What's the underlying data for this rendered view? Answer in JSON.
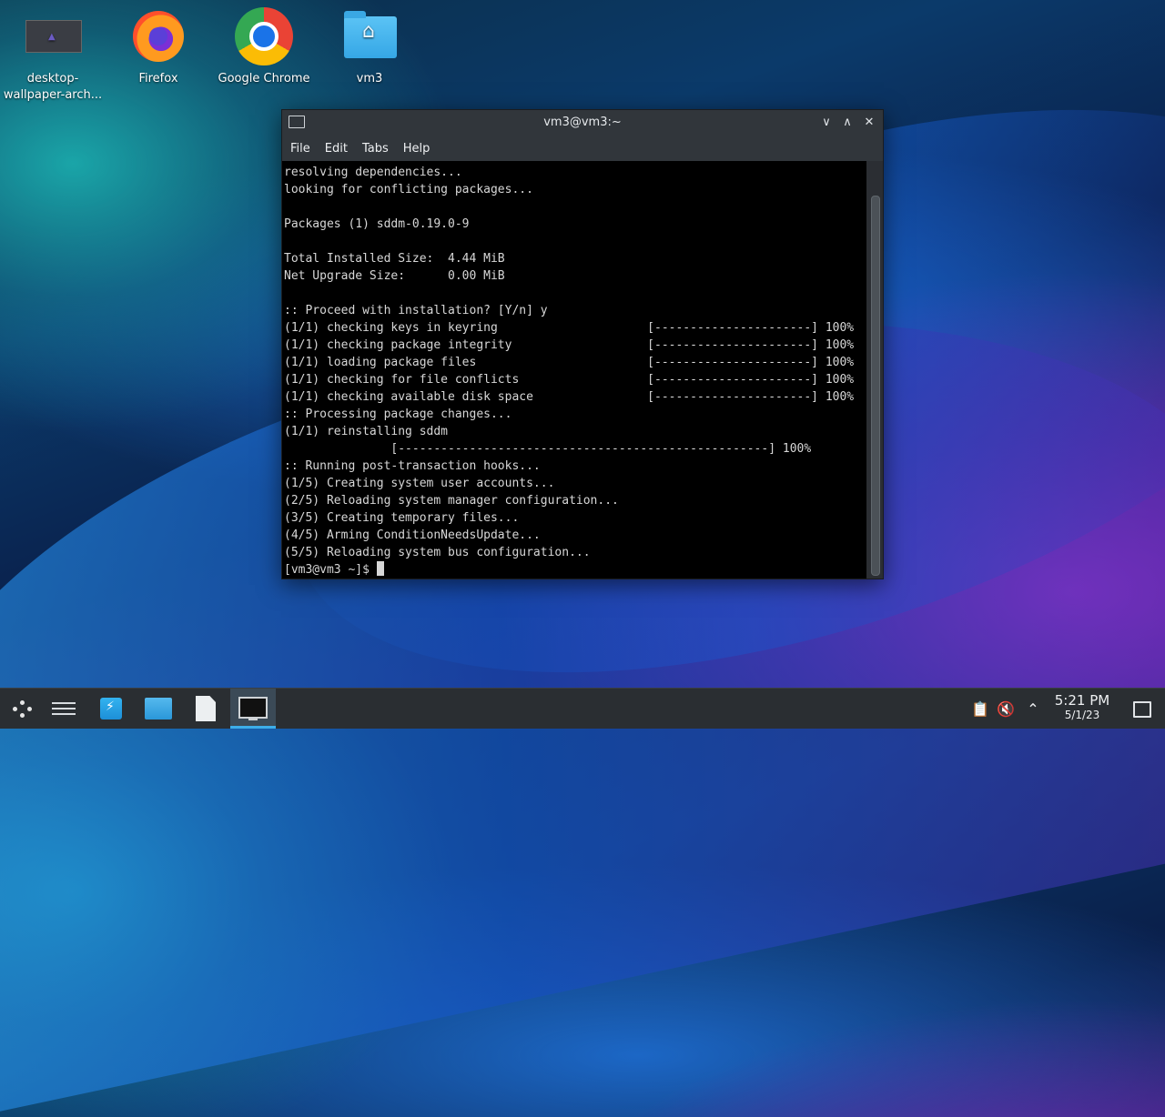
{
  "desktop": {
    "icons": [
      {
        "label": "desktop-\nwallpaper-arch...",
        "icon": "image-thumbnail-icon"
      },
      {
        "label": "Firefox",
        "icon": "firefox-icon"
      },
      {
        "label": "Google Chrome",
        "icon": "chrome-icon"
      },
      {
        "label": "vm3",
        "icon": "home-folder-icon"
      }
    ]
  },
  "window": {
    "title": "vm3@vm3:~",
    "controls": {
      "minimize": "∨",
      "maximize": "∧",
      "close": "✕"
    },
    "menu": [
      "File",
      "Edit",
      "Tabs",
      "Help"
    ]
  },
  "terminal": {
    "lines": [
      "resolving dependencies...",
      "looking for conflicting packages...",
      "",
      "Packages (1) sddm-0.19.0-9",
      "",
      "Total Installed Size:  4.44 MiB",
      "Net Upgrade Size:      0.00 MiB",
      "",
      ":: Proceed with installation? [Y/n] y",
      "(1/1) checking keys in keyring                     [----------------------] 100%",
      "(1/1) checking package integrity                   [----------------------] 100%",
      "(1/1) loading package files                        [----------------------] 100%",
      "(1/1) checking for file conflicts                  [----------------------] 100%",
      "(1/1) checking available disk space                [----------------------] 100%",
      ":: Processing package changes...",
      "(1/1) reinstalling sddm",
      "               [----------------------------------------------------] 100%",
      ":: Running post-transaction hooks...",
      "(1/5) Creating system user accounts...",
      "(2/5) Reloading system manager configuration...",
      "(3/5) Creating temporary files...",
      "(4/5) Arming ConditionNeedsUpdate...",
      "(5/5) Reloading system bus configuration..."
    ],
    "prompt": "[vm3@vm3 ~]$ "
  },
  "taskbar": {
    "items": [
      {
        "name": "application-launcher",
        "icon": "launcher-icon"
      },
      {
        "name": "system-settings",
        "icon": "settings-sliders-icon"
      },
      {
        "name": "discover",
        "icon": "store-bag-icon"
      },
      {
        "name": "dolphin",
        "icon": "folder-icon"
      },
      {
        "name": "text-editor",
        "icon": "document-icon"
      },
      {
        "name": "konsole",
        "icon": "terminal-icon"
      }
    ],
    "tray_icons": [
      "clipboard-icon",
      "volume-muted-icon",
      "chevron-up-icon"
    ],
    "clock": {
      "time": "5:21 PM",
      "date": "5/1/23"
    }
  }
}
